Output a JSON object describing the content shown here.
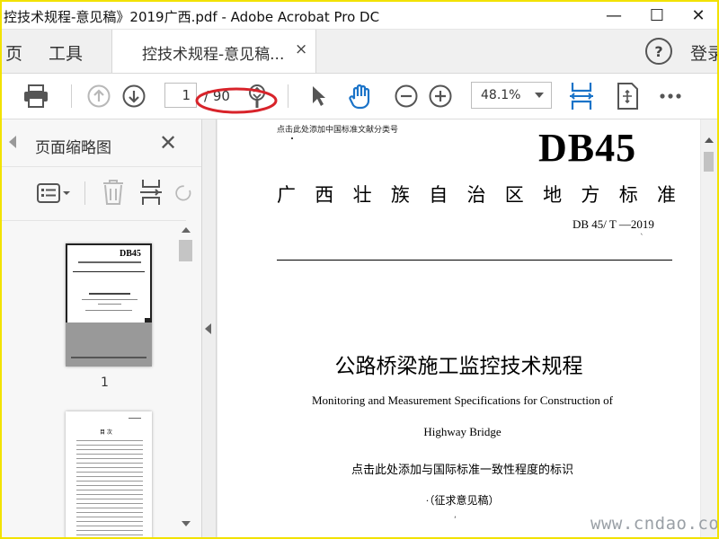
{
  "window": {
    "title": "控技术规程-意见稿》2019广西.pdf - Adobe Acrobat Pro DC",
    "minimize": "—",
    "maximize": "☐",
    "close": "✕"
  },
  "menu": {
    "home_partial": "页",
    "tools": "工具",
    "tab_label": "控技术规程-意见稿...",
    "tab_close": "×",
    "help": "?",
    "login_partial": "登录"
  },
  "toolbar": {
    "page_current": "1",
    "page_total": "/ 90",
    "zoom": "48.1%"
  },
  "panel": {
    "title": "页面缩略图",
    "close": "✕",
    "thumb1_label": "1",
    "thumb1_db": "DB45",
    "thumb2_heading": "目 次"
  },
  "document": {
    "classification_note": "点击此处添加中国标准文献分类号",
    "db_code": "DB45",
    "region_standard": "广 西 壮 族 自 治 区 地 方 标 准",
    "std_number": "DB 45/ T —2019",
    "title_cn": "公路桥梁施工监控技术规程",
    "title_en_line1": "Monitoring and Measurement Specifications for Construction of",
    "title_en_line2": "Highway Bridge",
    "consistency_note": "点击此处添加与国际标准一致性程度的标识",
    "draft_note": "·（征求意见稿）"
  },
  "watermark": "www.cndao.com",
  "colors": {
    "frame": "#f2e200",
    "annotation_red": "#d8232a",
    "accent_blue": "#1a73c8"
  }
}
